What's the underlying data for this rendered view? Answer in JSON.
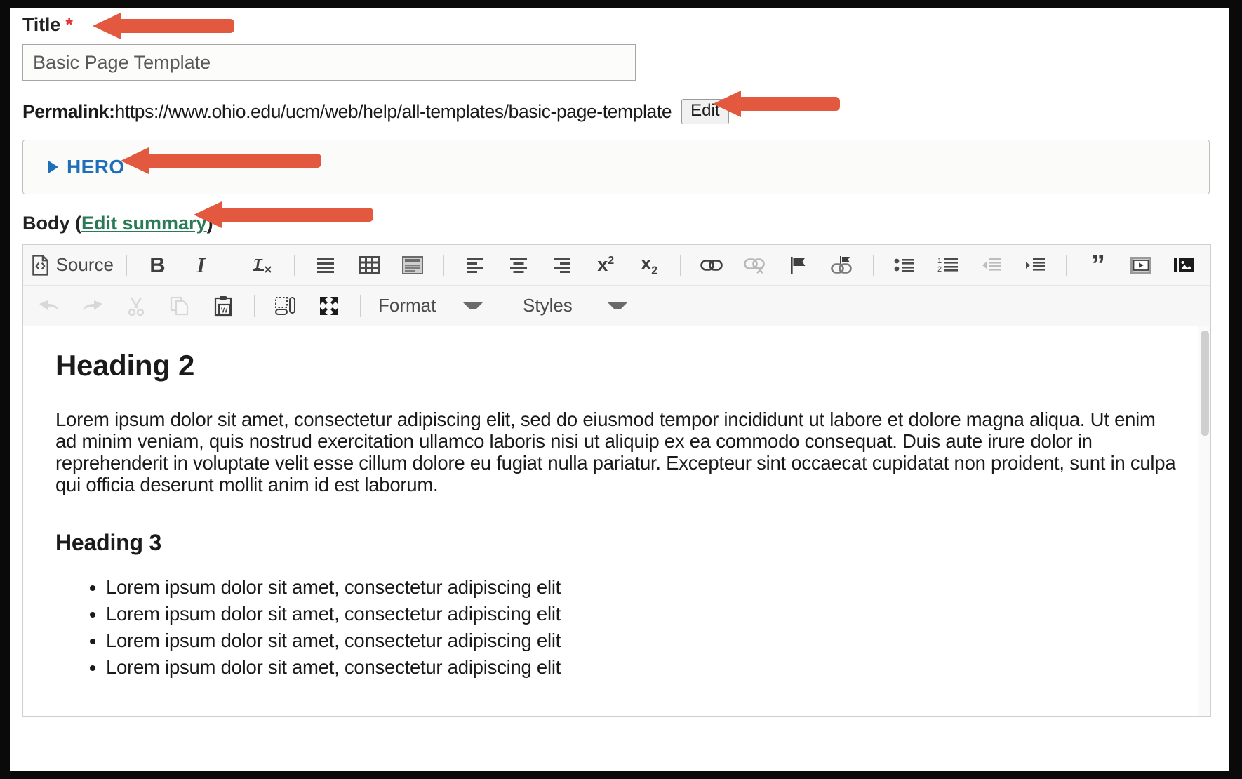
{
  "form": {
    "title_label": "Title",
    "required_mark": "*",
    "title_value": "Basic Page Template",
    "permalink_label": "Permalink:",
    "permalink_url": "https://www.ohio.edu/ucm/web/help/all-templates/basic-page-template",
    "permalink_edit_button": "Edit",
    "hero_section_label": "HERO",
    "body_label_prefix": "Body (",
    "body_label_link": "Edit summary",
    "body_label_suffix": ")"
  },
  "toolbar": {
    "row1": [
      {
        "name": "source-icon",
        "label": "Source"
      },
      {
        "name": "bold-icon",
        "label": "B"
      },
      {
        "name": "italic-icon",
        "label": "I"
      },
      {
        "name": "remove-format-icon",
        "label": "Tx"
      },
      {
        "name": "justify-icon",
        "label": ""
      },
      {
        "name": "table-icon",
        "label": ""
      },
      {
        "name": "templates-icon",
        "label": ""
      },
      {
        "name": "align-left-icon",
        "label": ""
      },
      {
        "name": "align-center-icon",
        "label": ""
      },
      {
        "name": "align-right-icon",
        "label": ""
      },
      {
        "name": "superscript-icon",
        "label": "x2"
      },
      {
        "name": "subscript-icon",
        "label": "x2"
      },
      {
        "name": "link-icon",
        "label": ""
      },
      {
        "name": "unlink-icon",
        "label": ""
      },
      {
        "name": "anchor-flag-icon",
        "label": ""
      },
      {
        "name": "anchor-link-icon",
        "label": ""
      },
      {
        "name": "bulleted-list-icon",
        "label": ""
      },
      {
        "name": "numbered-list-icon",
        "label": ""
      },
      {
        "name": "outdent-icon",
        "label": ""
      },
      {
        "name": "indent-icon",
        "label": ""
      },
      {
        "name": "blockquote-icon",
        "label": "”"
      },
      {
        "name": "video-embed-icon",
        "label": ""
      },
      {
        "name": "image-gallery-icon",
        "label": ""
      }
    ],
    "row2": [
      {
        "name": "undo-icon",
        "label": ""
      },
      {
        "name": "redo-icon",
        "label": ""
      },
      {
        "name": "cut-icon",
        "label": ""
      },
      {
        "name": "copy-icon",
        "label": ""
      },
      {
        "name": "paste-from-word-icon",
        "label": ""
      },
      {
        "name": "show-blocks-icon",
        "label": ""
      },
      {
        "name": "maximize-icon",
        "label": ""
      }
    ],
    "format_dropdown": "Format",
    "styles_dropdown": "Styles"
  },
  "body_content": {
    "heading2": "Heading 2",
    "paragraph": "Lorem ipsum dolor sit amet, consectetur adipiscing elit, sed do eiusmod tempor incididunt ut labore et dolore magna aliqua. Ut enim ad minim veniam, quis nostrud exercitation ullamco laboris nisi ut aliquip ex ea commodo consequat. Duis aute irure dolor in reprehenderit in voluptate velit esse cillum dolore eu fugiat nulla pariatur. Excepteur sint occaecat cupidatat non proident, sunt in culpa qui officia deserunt mollit anim id est laborum.",
    "heading3": "Heading 3",
    "list_items": [
      "Lorem ipsum dolor sit amet, consectetur adipiscing elit",
      "Lorem ipsum dolor sit amet, consectetur adipiscing elit",
      "Lorem ipsum dolor sit amet, consectetur adipiscing elit",
      "Lorem ipsum dolor sit amet, consectetur adipiscing elit"
    ]
  },
  "annotations": {
    "arrow_color": "#e2593f",
    "arrows": [
      {
        "name": "arrow-pointing-to-title",
        "target": "Title"
      },
      {
        "name": "arrow-pointing-to-permalink-edit",
        "target": "Edit"
      },
      {
        "name": "arrow-pointing-to-hero",
        "target": "HERO"
      },
      {
        "name": "arrow-pointing-to-edit-summary",
        "target": "Edit summary"
      }
    ]
  },
  "colors": {
    "link_blue": "#1f6fb8",
    "link_green": "#2a7a57",
    "required_red": "#e23636",
    "arrow_orange": "#e2593f"
  }
}
